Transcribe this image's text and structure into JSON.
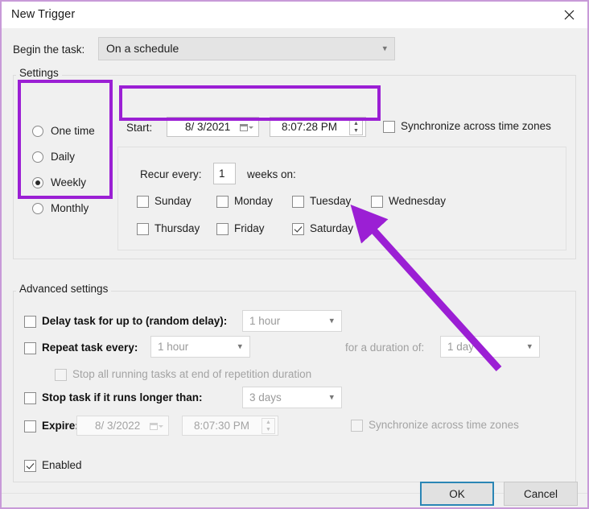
{
  "window": {
    "title": "New Trigger",
    "close_icon": "close-icon",
    "border_color": "#c89ad8"
  },
  "begin": {
    "label": "Begin the task:",
    "label_accel": "B",
    "value": "On a schedule",
    "chevron": "chevron-down-icon"
  },
  "settings": {
    "group_title": "Settings",
    "schedule_options": [
      {
        "label": "One time",
        "selected": false
      },
      {
        "label": "Daily",
        "selected": false
      },
      {
        "label": "Weekly",
        "selected": true
      },
      {
        "label": "Monthly",
        "selected": false
      }
    ],
    "start": {
      "label": "Start:",
      "date": "8/ 3/2021",
      "time": "8:07:28 PM",
      "date_picker_icon": "calendar-dropdown-icon",
      "time_spinner_icon": "spinner-updown-icon"
    },
    "sync_timezones": {
      "label": "Synchronize across time zones",
      "checked": false,
      "disabled": false
    },
    "weekly": {
      "recur_label": "Recur every:",
      "recur_value": "1",
      "weeks_on_label": "weeks on:",
      "days": [
        {
          "label": "Sunday",
          "checked": false
        },
        {
          "label": "Monday",
          "checked": false
        },
        {
          "label": "Tuesday",
          "checked": false
        },
        {
          "label": "Wednesday",
          "checked": false
        },
        {
          "label": "Thursday",
          "checked": false
        },
        {
          "label": "Friday",
          "checked": false
        },
        {
          "label": "Saturday",
          "checked": true
        }
      ]
    }
  },
  "advanced": {
    "group_title": "Advanced settings",
    "delay_task": {
      "label": "Delay task for up to (random delay):",
      "checked": false,
      "value": "1 hour"
    },
    "repeat_task": {
      "label": "Repeat task every:",
      "checked": false,
      "value": "1 hour",
      "duration_label": "for a duration of:",
      "duration_value": "1 day"
    },
    "stop_all_running": {
      "label": "Stop all running tasks at end of repetition duration",
      "checked": false,
      "disabled": true
    },
    "stop_task_longer": {
      "label": "Stop task if it runs longer than:",
      "checked": false,
      "value": "3 days"
    },
    "expire": {
      "label": "Expire:",
      "checked": false,
      "date": "8/ 3/2022",
      "time": "8:07:30 PM"
    },
    "expire_sync": {
      "label": "Synchronize across time zones",
      "checked": false,
      "disabled": true
    }
  },
  "enabled": {
    "label": "Enabled",
    "checked": true
  },
  "buttons": {
    "ok": "OK",
    "cancel": "Cancel"
  },
  "annotations": {
    "highlight_color": "#9b1fd4",
    "arrow_color": "#9b1fd4"
  }
}
